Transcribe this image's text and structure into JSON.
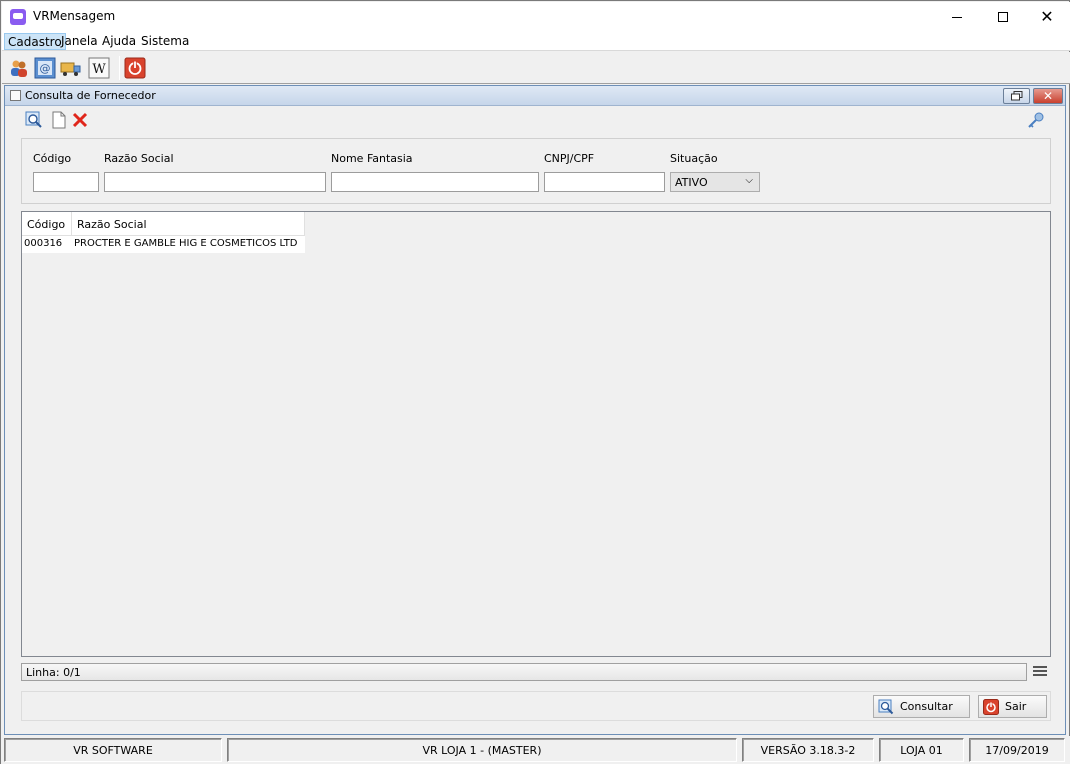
{
  "window": {
    "title": "VRMensagem"
  },
  "menu": [
    "Cadastro",
    "Janela",
    "Ajuda",
    "Sistema"
  ],
  "toolbar": {
    "icons": [
      "users-icon",
      "email-icon",
      "truck-icon",
      "wiki-icon",
      "power-icon"
    ]
  },
  "inner_window": {
    "title": "Consulta de Fornecedor"
  },
  "filters": {
    "codigo_label": "Código",
    "razao_label": "Razão Social",
    "fantasia_label": "Nome Fantasia",
    "cnpj_label": "CNPJ/CPF",
    "situacao_label": "Situação",
    "situacao_value": "ATIVO"
  },
  "grid": {
    "columns": [
      "Código",
      "Razão Social"
    ],
    "rows": [
      {
        "codigo": "000316",
        "razao": "PROCTER E GAMBLE HIG E COSMETICOS LTD"
      }
    ]
  },
  "status": {
    "linha": "Linha: 0/1"
  },
  "buttons": {
    "consultar": "Consultar",
    "sair": "Sair"
  },
  "statusbar": {
    "company": "VR SOFTWARE",
    "store": "VR LOJA 1 - (MASTER)",
    "version": "VERSÃO 3.18.3-2",
    "loja": "LOJA 01",
    "date": "17/09/2019"
  },
  "colors": {
    "accent": "#8a5cf0",
    "inner_title": "#c6d6ea",
    "close_red": "#c9402f"
  }
}
